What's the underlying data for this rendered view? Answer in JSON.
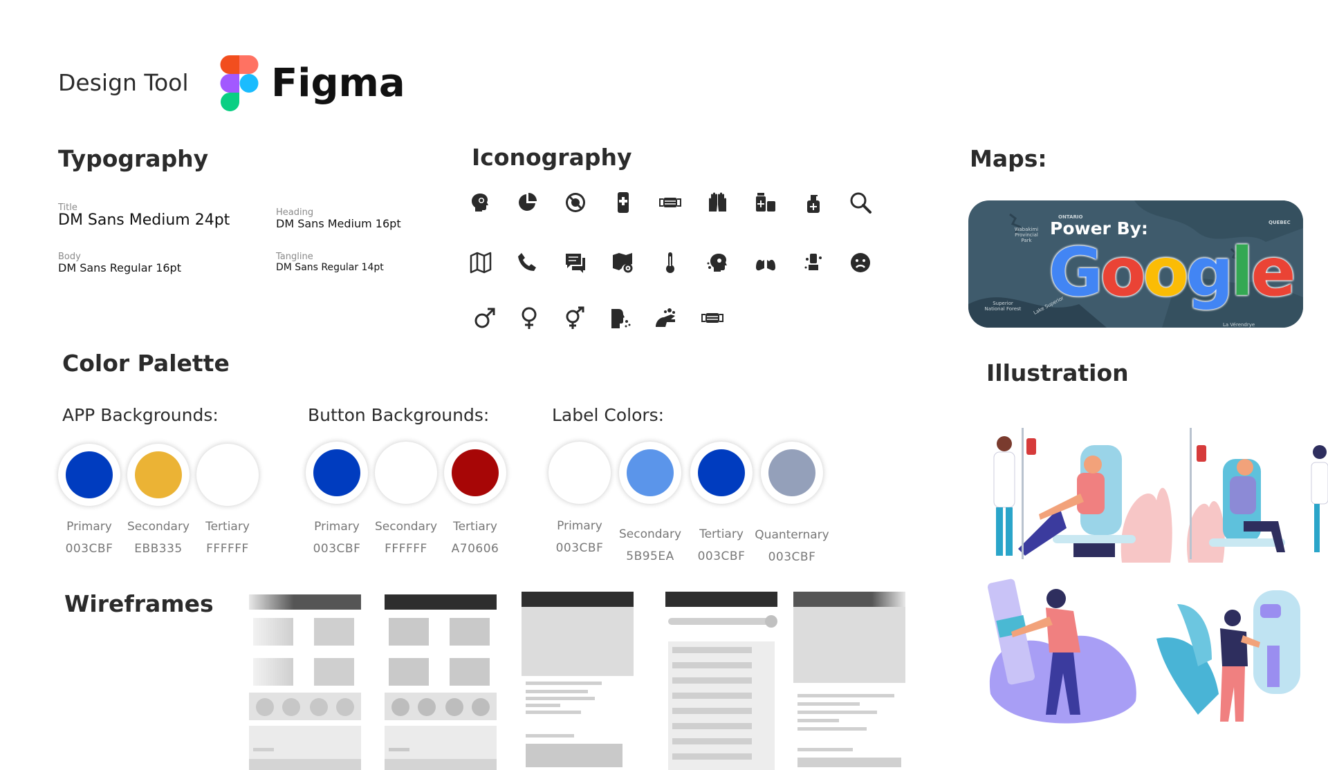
{
  "header": {
    "title": "Design Tool",
    "tool_name": "Figma"
  },
  "typography": {
    "heading": "Typography",
    "items": [
      {
        "label": "Title",
        "value": "DM Sans Medium 24pt"
      },
      {
        "label": "Heading",
        "value": "DM Sans Medium 16pt"
      },
      {
        "label": "Body",
        "value": "DM Sans Regular 16pt"
      },
      {
        "label": "Tangline",
        "value": "DM Sans Regular 14pt"
      }
    ]
  },
  "iconography": {
    "heading": "Iconography",
    "icons": [
      "virus-head-icon",
      "pie-chart-icon",
      "virus-blocked-icon",
      "medical-phone-icon",
      "face-mask-icon",
      "gloves-icon",
      "medicine-bottles-icon",
      "sanitizer-icon",
      "search-icon",
      "map-icon",
      "phone-icon",
      "chat-icon",
      "map-pin-icon",
      "thermometer-icon",
      "sick-head-icon",
      "lungs-icon",
      "hand-wash-icon",
      "sad-face-icon",
      "male-icon",
      "female-icon",
      "gender-icon",
      "sneeze-icon",
      "soap-wash-icon",
      "mask-icon-2"
    ]
  },
  "maps": {
    "heading": "Maps:",
    "power_by": "Power By:",
    "brand": "Google",
    "map_labels": {
      "ontario": "ONTARIO",
      "quebec": "QUEBEC",
      "wabakimi": "Wabakimi Provincial Park",
      "superior": "Superior National Forest",
      "lake": "Lake Superior",
      "verendrye": "La Vérendrye"
    },
    "brand_colors": [
      "#4285F4",
      "#EA4335",
      "#FBBC05",
      "#4285F4",
      "#34A853",
      "#EA4335"
    ]
  },
  "color_palette": {
    "heading": "Color Palette",
    "groups": [
      {
        "title": "APP Backgrounds:",
        "swatches": [
          {
            "name": "Primary",
            "hex": "003CBF",
            "color": "#003CBF"
          },
          {
            "name": "Secondary",
            "hex": "EBB335",
            "color": "#EBB335"
          },
          {
            "name": "Tertiary",
            "hex": "FFFFFF",
            "color": "#FFFFFF"
          }
        ]
      },
      {
        "title": "Button Backgrounds:",
        "swatches": [
          {
            "name": "Primary",
            "hex": "003CBF",
            "color": "#003CBF"
          },
          {
            "name": "Secondary",
            "hex": "FFFFFF",
            "color": "#FFFFFF"
          },
          {
            "name": "Tertiary",
            "hex": "A70606",
            "color": "#A70606"
          }
        ]
      },
      {
        "title": "Label Colors:",
        "swatches": [
          {
            "name": "Primary",
            "hex": "003CBF",
            "color": "#FFFFFF"
          },
          {
            "name": "Secondary",
            "hex": "5B95EA",
            "color": "#5B95EA"
          },
          {
            "name": "Tertiary",
            "hex": "003CBF",
            "color": "#003CBF"
          },
          {
            "name": "Quanternary",
            "hex": "003CBF",
            "color": "#94A0BA"
          }
        ]
      }
    ]
  },
  "illustration": {
    "heading": "Illustration"
  },
  "wireframes": {
    "heading": "Wireframes"
  }
}
